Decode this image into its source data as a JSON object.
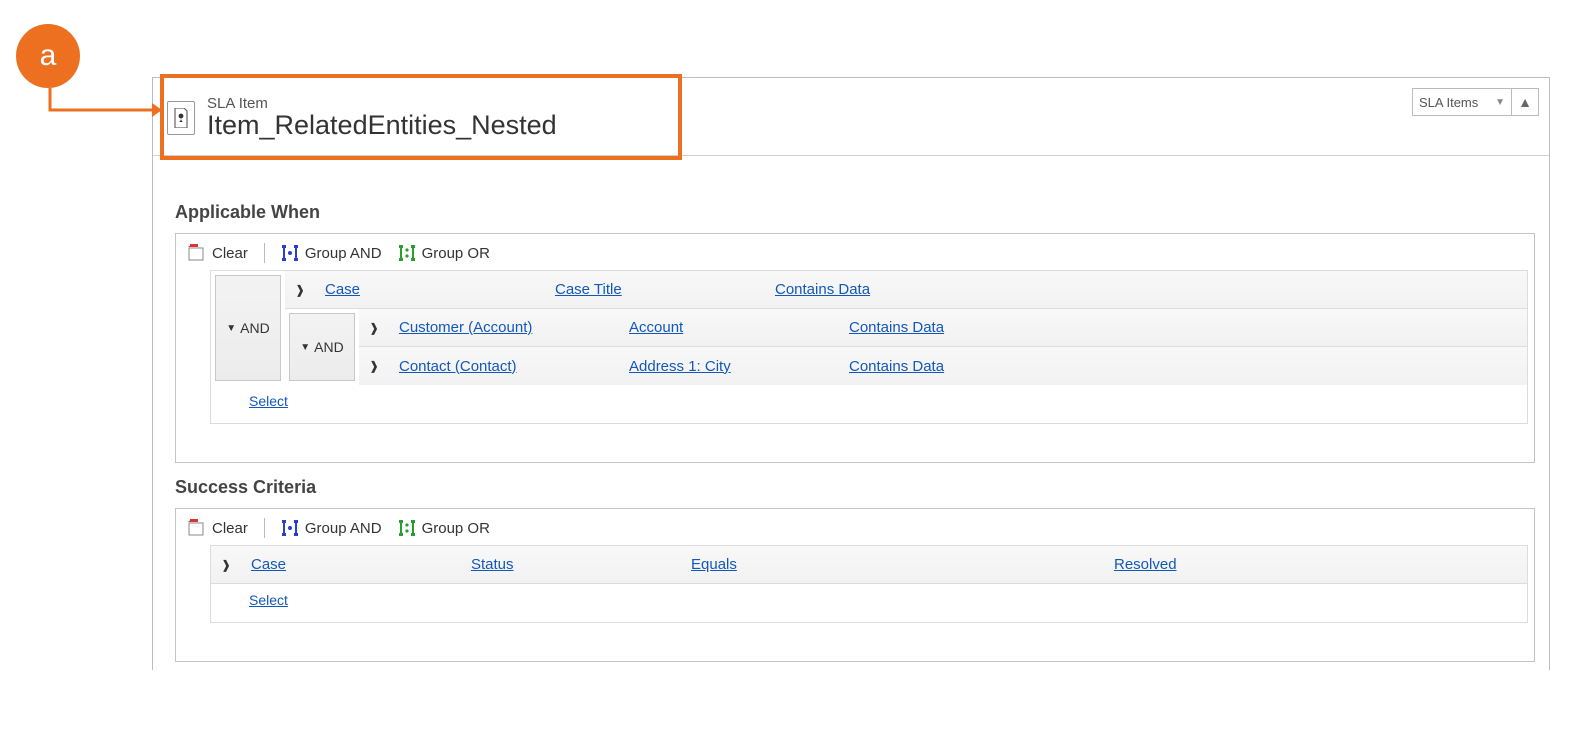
{
  "annotation": {
    "letter": "a"
  },
  "header": {
    "supertitle": "SLA Item",
    "title": "Item_RelatedEntities_Nested",
    "nav_select_value": "SLA Items"
  },
  "sections": {
    "applicable_when": {
      "label": "Applicable When",
      "toolbar": {
        "clear": "Clear",
        "group_and": "Group AND",
        "group_or": "Group OR"
      },
      "outer_and": "AND",
      "inner_and": "AND",
      "rows": {
        "r1": {
          "entity": "Case",
          "field": "Case Title",
          "op": "Contains Data"
        },
        "r2": {
          "entity": "Customer (Account)",
          "field": "Account",
          "op": "Contains Data"
        },
        "r3": {
          "entity": "Contact (Contact)",
          "field": "Address 1: City",
          "op": "Contains Data"
        }
      },
      "select": "Select"
    },
    "success_criteria": {
      "label": "Success Criteria",
      "toolbar": {
        "clear": "Clear",
        "group_and": "Group AND",
        "group_or": "Group OR"
      },
      "row": {
        "entity": "Case",
        "field": "Status",
        "op": "Equals",
        "value": "Resolved"
      },
      "select": "Select"
    }
  }
}
